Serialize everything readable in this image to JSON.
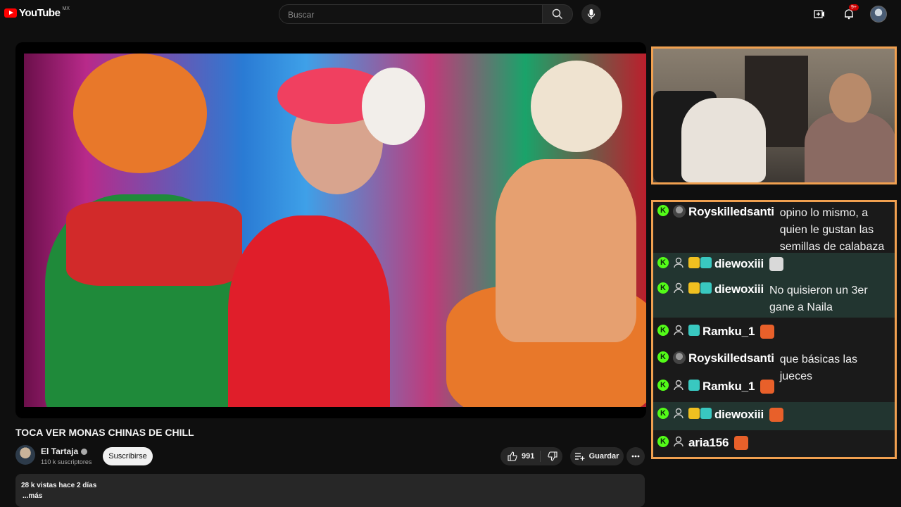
{
  "header": {
    "logo_text": "YouTube",
    "region": "MX",
    "search_placeholder": "Buscar",
    "notification_count": "9+"
  },
  "video": {
    "title": "TOCA VER MONAS CHINAS DE CHILL"
  },
  "channel": {
    "name": "El Tartaja",
    "subscribers": "110 k suscriptores",
    "subscribe_label": "Suscribirse"
  },
  "actions": {
    "like_count": "991",
    "save_label": "Guardar"
  },
  "description": {
    "meta": "28 k vistas  hace 2 días",
    "more": "...más"
  },
  "chat": {
    "messages": [
      {
        "user": "Royskilledsanti",
        "text": "opino lo mismo, a quien le gustan las semillas de calabaza con chamoy?"
      },
      {
        "user": "diewoxiii",
        "text": "",
        "emote": "cat-emote"
      },
      {
        "user": "diewoxiii",
        "text": "No quisieron un 3er gane a Naila"
      },
      {
        "user": "Ramku_1",
        "text": "",
        "emote": "fire-emote"
      },
      {
        "user": "Royskilledsanti",
        "text": "que básicas las jueces"
      },
      {
        "user": "Ramku_1",
        "text": "",
        "emote": "fire-emote"
      },
      {
        "user": "diewoxiii",
        "text": "",
        "emote": "fire-emote"
      },
      {
        "user": "aria156",
        "text": "",
        "emote": "fire-emote"
      }
    ]
  },
  "colors": {
    "brand_red": "#ff0000",
    "overlay_border": "#f0a050",
    "kick_green": "#53fc18",
    "chat_highlight": "#223530"
  }
}
